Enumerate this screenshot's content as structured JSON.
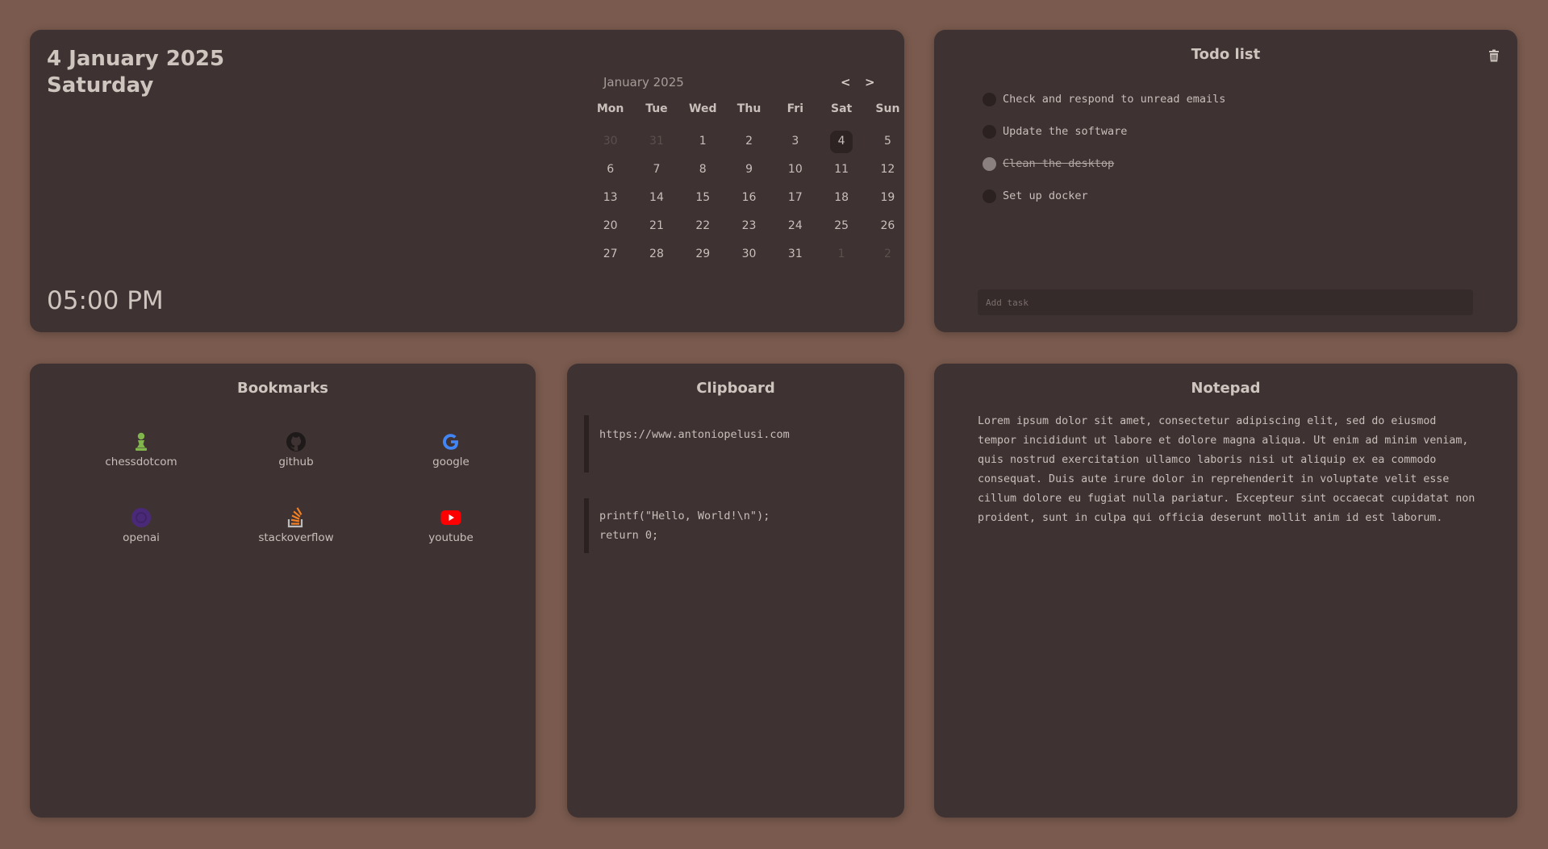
{
  "date_panel": {
    "date": "4 January 2025",
    "weekday": "Saturday",
    "time": "05:00 PM"
  },
  "calendar": {
    "month_label": "January 2025",
    "prev_label": "<",
    "next_label": ">",
    "weekdays": [
      "Mon",
      "Tue",
      "Wed",
      "Thu",
      "Fri",
      "Sat",
      "Sun"
    ],
    "days": [
      [
        "30",
        "31",
        "1",
        "2",
        "3",
        "4",
        "5"
      ],
      [
        "6",
        "7",
        "8",
        "9",
        "10",
        "11",
        "12"
      ],
      [
        "13",
        "14",
        "15",
        "16",
        "17",
        "18",
        "19"
      ],
      [
        "20",
        "21",
        "22",
        "23",
        "24",
        "25",
        "26"
      ],
      [
        "27",
        "28",
        "29",
        "30",
        "31",
        "1",
        "2"
      ]
    ],
    "today": "4"
  },
  "todo": {
    "title": "Todo list",
    "trash_icon": "trash-icon",
    "items": [
      {
        "text": "Check and respond to unread emails",
        "done": false
      },
      {
        "text": "Update the software",
        "done": false
      },
      {
        "text": "Clean the desktop",
        "done": true
      },
      {
        "text": "Set up docker",
        "done": false
      }
    ],
    "add_placeholder": "Add task"
  },
  "bookmarks": {
    "title": "Bookmarks",
    "items": [
      {
        "label": "chessdotcom",
        "icon": "chess-pawn-icon",
        "color": "#81b64c"
      },
      {
        "label": "github",
        "icon": "github-icon",
        "color": "#1f1a1a"
      },
      {
        "label": "google",
        "icon": "google-icon",
        "color": "#4285f4"
      },
      {
        "label": "openai",
        "icon": "openai-icon",
        "color": "#4a2a78"
      },
      {
        "label": "stackoverflow",
        "icon": "stackoverflow-icon",
        "color": "#f48024"
      },
      {
        "label": "youtube",
        "icon": "youtube-icon",
        "color": "#ff0000"
      }
    ]
  },
  "clipboard": {
    "title": "Clipboard",
    "items": [
      {
        "text": "https://www.antoniopelusi.com"
      },
      {
        "lines": [
          "printf(\"Hello, World!\\n\");",
          "return 0;"
        ]
      }
    ]
  },
  "notepad": {
    "title": "Notepad",
    "text": "Lorem ipsum dolor sit amet, consectetur adipiscing elit, sed do eiusmod tempor incididunt ut labore et dolore magna aliqua. Ut enim ad minim veniam, quis nostrud exercitation ullamco laboris nisi ut aliquip ex ea commodo consequat. Duis aute irure dolor in reprehenderit in voluptate velit esse cillum dolore eu fugiat nulla pariatur. Excepteur sint occaecat cupidatat non proident, sunt in culpa qui officia deserunt mollit anim id est laborum."
  },
  "colors": {
    "background": "#7a5a4e",
    "panel": "#3e3232",
    "text": "#c9bfba"
  }
}
